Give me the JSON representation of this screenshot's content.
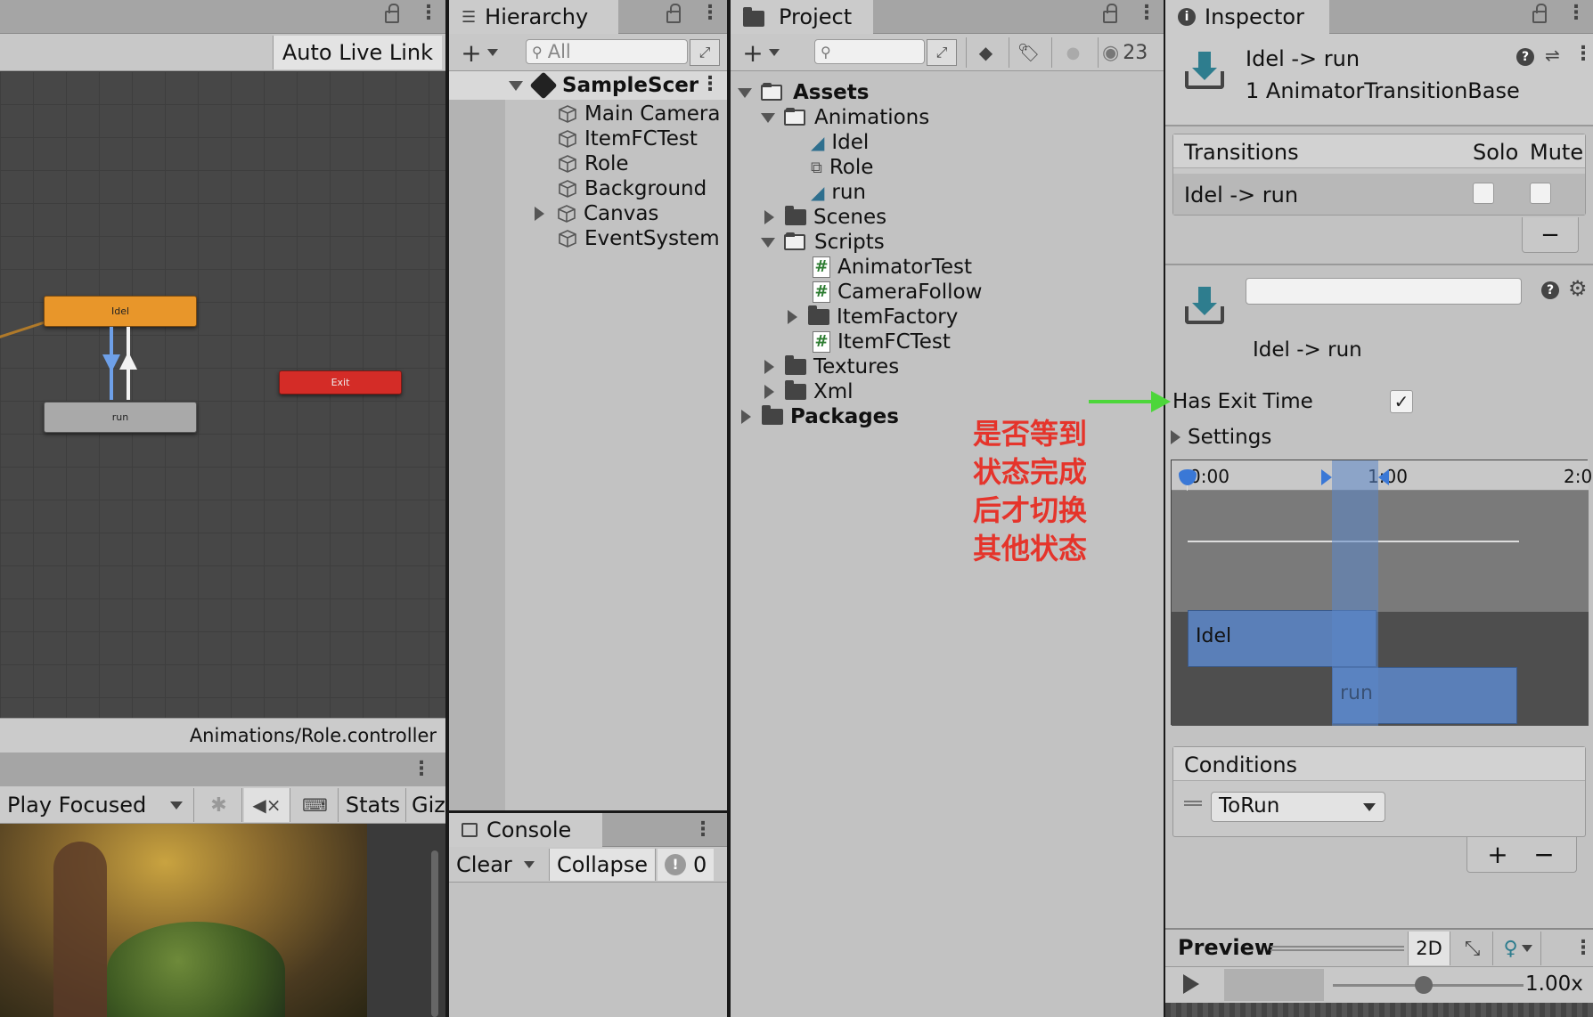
{
  "animator": {
    "auto_live_link": "Auto Live Link",
    "states": {
      "idle": "Idel",
      "run": "run",
      "exit": "Exit"
    },
    "footer_path": "Animations/Role.controller"
  },
  "game": {
    "play_mode": "Play Focused",
    "stats": "Stats",
    "gizmos": "Giz"
  },
  "hierarchy": {
    "tab": "Hierarchy",
    "search_placeholder": "All",
    "scene": "SampleScer",
    "items": [
      "Main Camera",
      "ItemFCTest",
      "Role",
      "Background",
      "Canvas",
      "EventSystem"
    ]
  },
  "console": {
    "tab": "Console",
    "clear": "Clear",
    "collapse": "Collapse",
    "error_count": "0"
  },
  "project": {
    "tab": "Project",
    "visible_count": "23",
    "assets": "Assets",
    "animations": "Animations",
    "anim_items": [
      "Idel",
      "Role",
      "run"
    ],
    "scenes": "Scenes",
    "scripts": "Scripts",
    "script_items": [
      "AnimatorTest",
      "CameraFollow",
      "ItemFactory",
      "ItemFCTest"
    ],
    "textures": "Textures",
    "xml": "Xml",
    "packages": "Packages"
  },
  "annotation": {
    "lines": [
      "是否等到",
      "状态完成",
      "后才切换",
      "其他状态"
    ],
    "color": "#e5342b",
    "arrow_color": "#4cd63a"
  },
  "inspector": {
    "tab": "Inspector",
    "title": "Idel -> run",
    "subtitle": "1 AnimatorTransitionBase",
    "transitions_header": "Transitions",
    "solo": "Solo",
    "mute": "Mute",
    "transition_row": "Idel -> run",
    "transition_name": "Idel -> run",
    "has_exit_time": "Has Exit Time",
    "has_exit_time_checked": true,
    "settings": "Settings",
    "timeline": {
      "ticks": [
        "0:00",
        "1:00",
        "2:0"
      ],
      "clip_a": "Idel",
      "clip_b": "run"
    },
    "conditions": "Conditions",
    "condition_param": "ToRun",
    "preview": "Preview",
    "preview_2d": "2D",
    "speed": "1.00x"
  },
  "colors": {
    "idle_state": "#e8962a",
    "exit_state": "#d42c27",
    "run_state": "#a9a9a9",
    "accent_blue": "#5b86c9"
  }
}
